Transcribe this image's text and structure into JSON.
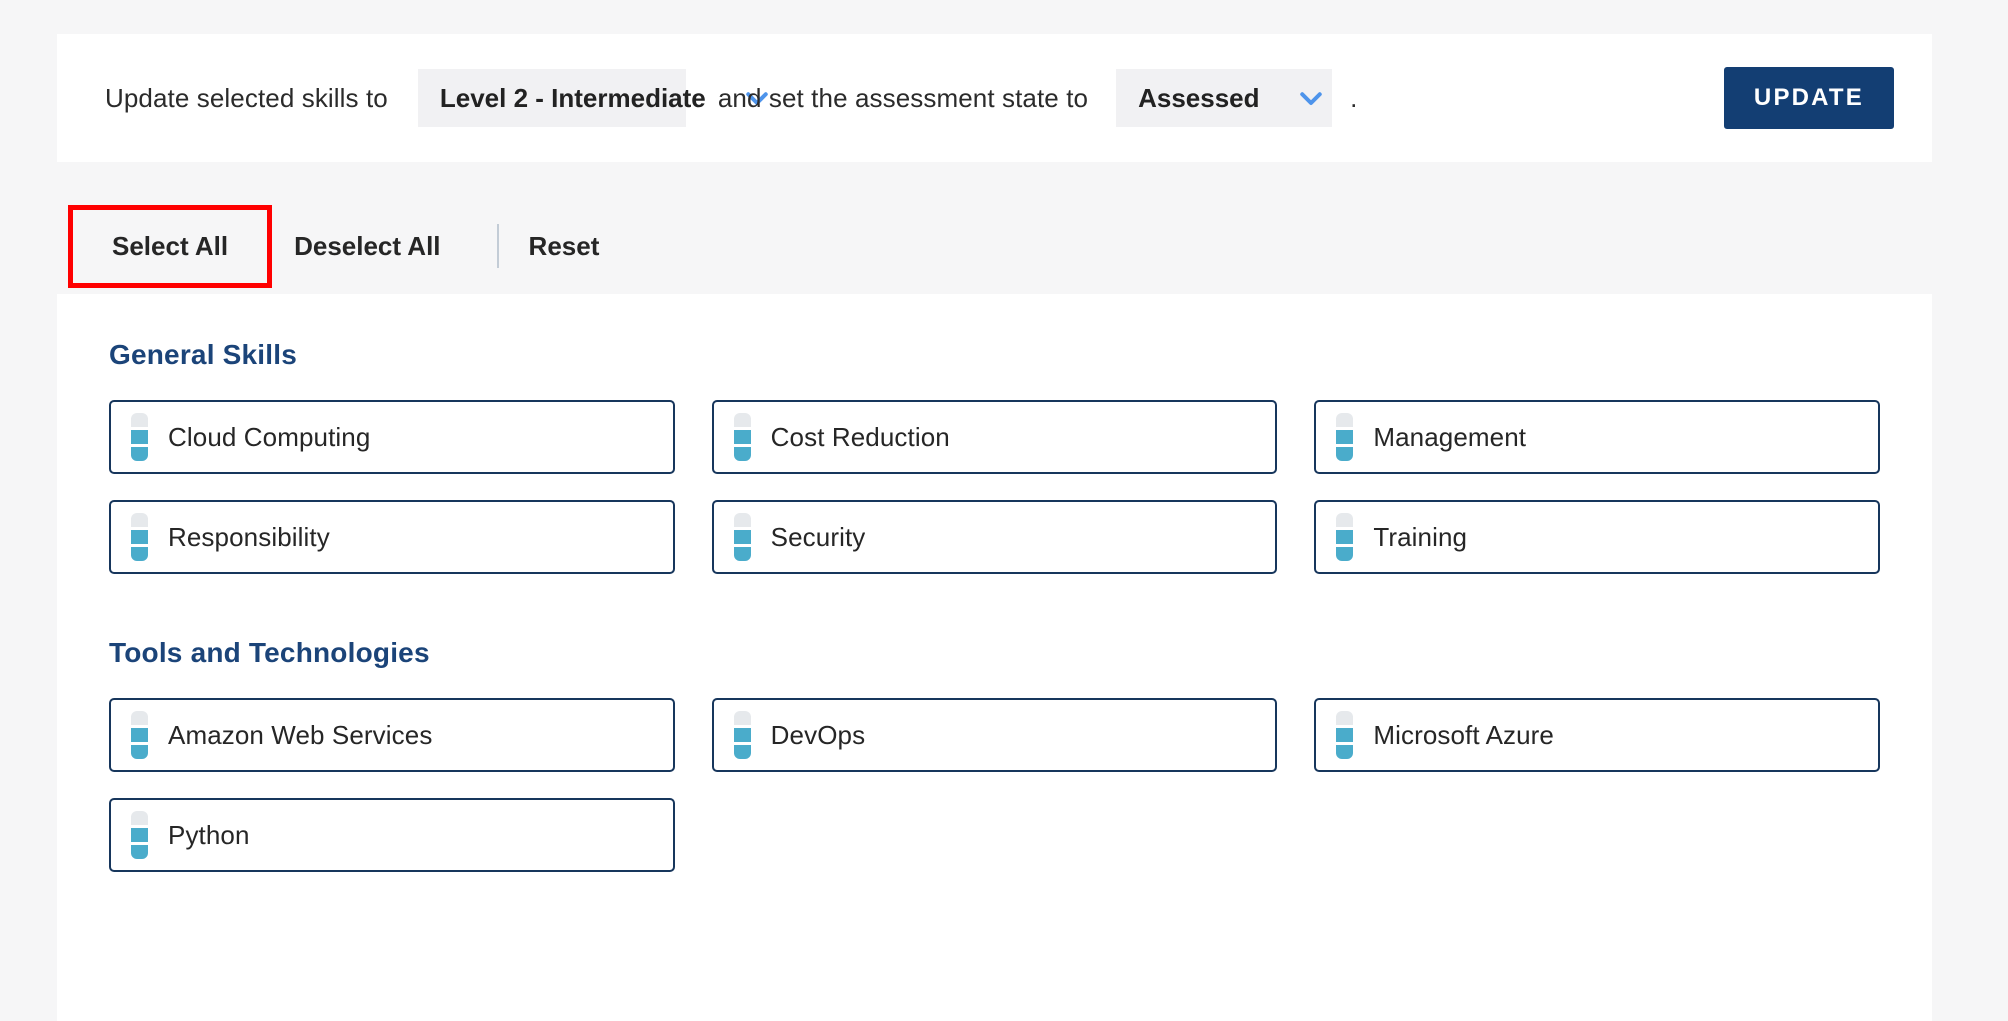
{
  "bulk_update": {
    "lead_label": "Update selected skills to",
    "level_select": {
      "value": "Level 2 - Intermediate",
      "icon": "chevron-down-icon"
    },
    "mid_label": "and set the assessment state to",
    "state_select": {
      "value": "Assessed",
      "icon": "chevron-down-icon"
    },
    "trailing_punctuation": ".",
    "update_button_label": "UPDATE",
    "accent_button_color": "#133e73",
    "chevron_color": "#4e94eb",
    "select_background": "#f1f1f3"
  },
  "actions": {
    "select_all": "Select All",
    "deselect_all": "Deselect All",
    "reset": "Reset",
    "highlight_color": "#ff0000",
    "highlighted_action": "Select All"
  },
  "sections": [
    {
      "id": "general-skills",
      "title": "General Skills",
      "skills": [
        {
          "name": "Cloud Computing",
          "level": 2,
          "max_level": 3
        },
        {
          "name": "Cost Reduction",
          "level": 2,
          "max_level": 3
        },
        {
          "name": "Management",
          "level": 2,
          "max_level": 3
        },
        {
          "name": "Responsibility",
          "level": 2,
          "max_level": 3
        },
        {
          "name": "Security",
          "level": 2,
          "max_level": 3
        },
        {
          "name": "Training",
          "level": 2,
          "max_level": 3
        }
      ]
    },
    {
      "id": "tools-and-technologies",
      "title": "Tools and Technologies",
      "skills": [
        {
          "name": "Amazon Web Services",
          "level": 2,
          "max_level": 3
        },
        {
          "name": "DevOps",
          "level": 2,
          "max_level": 3
        },
        {
          "name": "Microsoft Azure",
          "level": 2,
          "max_level": 3
        },
        {
          "name": "Python",
          "level": 2,
          "max_level": 3
        }
      ]
    }
  ],
  "theme": {
    "page_background": "#f6f6f7",
    "panel_background": "#ffffff",
    "section_title_color": "#1b4479",
    "card_border_color": "#17365c",
    "level_filled_color": "#4aaccb",
    "level_empty_color": "#e6e9ec"
  }
}
